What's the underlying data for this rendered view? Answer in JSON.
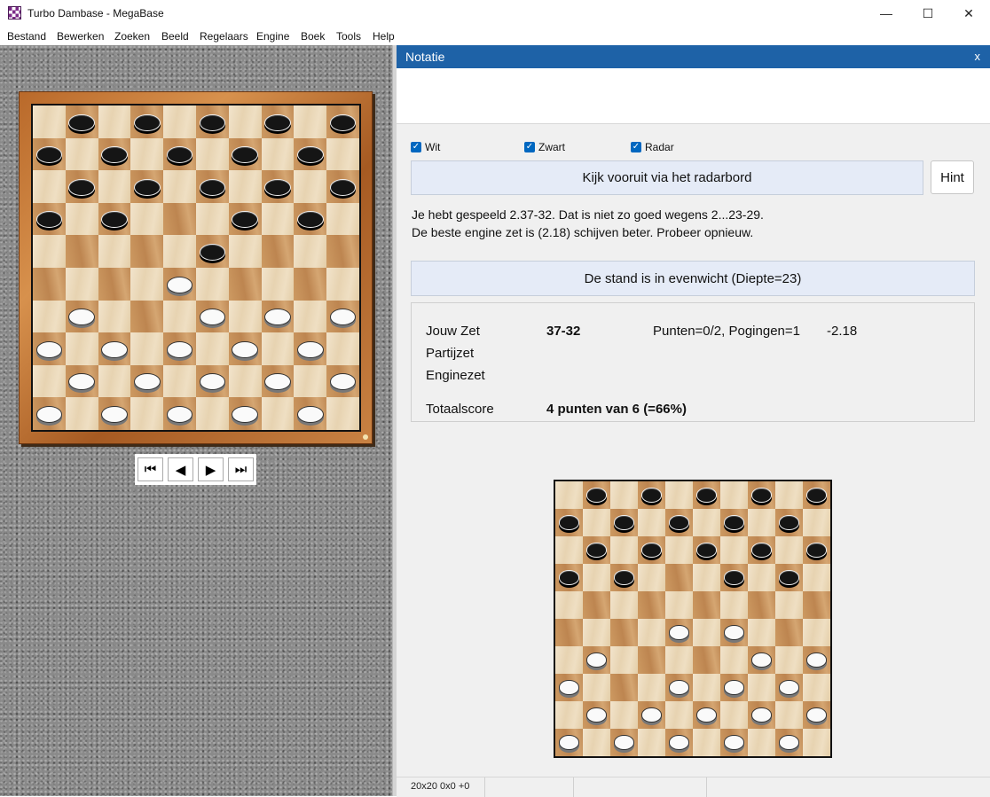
{
  "window": {
    "title": "Turbo Dambase - MegaBase",
    "minimize": "—",
    "maximize": "☐",
    "close": "✕"
  },
  "menu": [
    "Bestand",
    "Bewerken",
    "Zoeken",
    "Beeld",
    "Regelaars",
    "Engine",
    "Boek",
    "Tools",
    "Help"
  ],
  "main_board": {
    "rows": [
      ". b . b . b . b . b",
      "b . b . b . b . b .",
      ". b . b . b . b . b",
      "b . b . . . b . b .",
      ". . . . . b . . . .",
      ". . . . w . . . . .",
      ". w . . . w . w . w",
      "w . w . w . w . w .",
      ". w . w . w . w . w",
      "w . w . w . w . w ."
    ]
  },
  "nav_buttons": [
    "⏮",
    "◀",
    "▶",
    "⏭"
  ],
  "panel": {
    "title": "Notatie",
    "close": "x"
  },
  "checkboxes": [
    {
      "label": "Wit"
    },
    {
      "label": "Zwart"
    },
    {
      "label": "Radar"
    }
  ],
  "buttons": {
    "lookahead": "Kijk vooruit via het radarbord",
    "hint": "Hint",
    "evaluation": "De stand is in evenwicht (Diepte=23)"
  },
  "message": {
    "line1": "Je hebt gespeeld 2.37-32. Dat is niet zo goed wegens 2...23-29.",
    "line2": "De beste engine zet is (2.18) schijven beter. Probeer opnieuw."
  },
  "score": {
    "jouw_zet_label": "Jouw Zet",
    "jouw_zet_value": "37-32",
    "punten": "Punten=0/2, Pogingen=1",
    "diff": "-2.18",
    "partijzet_label": "Partijzet",
    "enginezet_label": "Enginezet",
    "totaal_label": "Totaalscore",
    "totaal_value": "4 punten van 6 (=66%)"
  },
  "radar_board": {
    "rows": [
      ". b . b . b . b . b",
      "b . b . b . b . b .",
      ". b . b . b . b . b",
      "b . b . . . b . b .",
      ". . . . . . . . . .",
      ". . . . w . w . . .",
      ". w . . . . . w . w",
      "w . . . w . w . w .",
      ". w . w . w . w . w",
      "w . w . w . w . w ."
    ]
  },
  "statusbar": {
    "cell1": "20x20 0x0 +0"
  },
  "colors": {
    "panel_header": "#1e62a7",
    "checkbox": "#0067c0",
    "button_bg": "#e5ebf7"
  }
}
